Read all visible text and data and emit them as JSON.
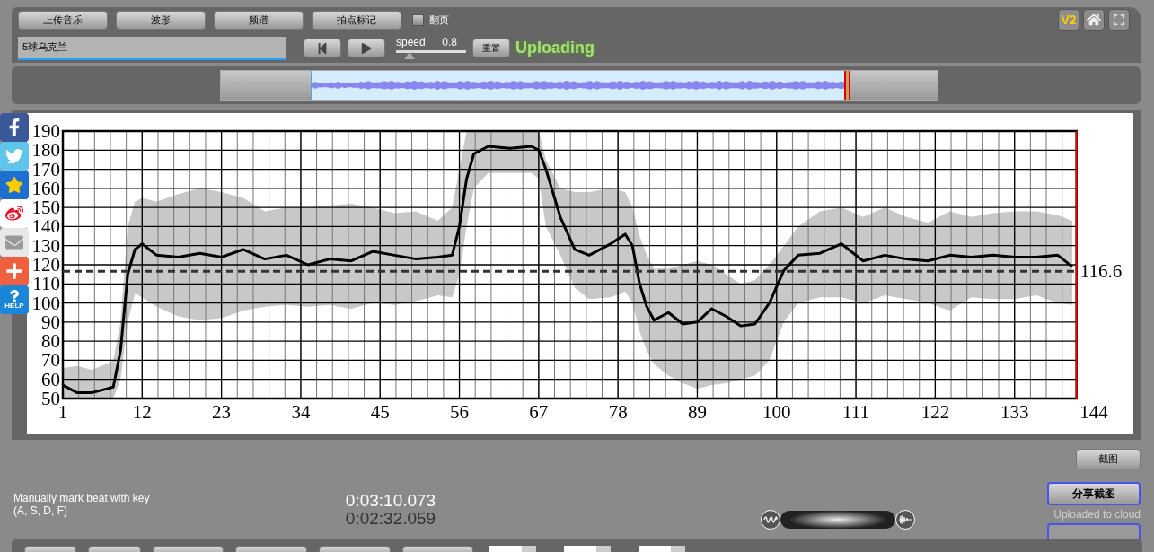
{
  "toolbar": {
    "buttons": [
      "上传音乐",
      "波形",
      "频谱",
      "拍点标记"
    ],
    "page_flip": {
      "label": "翻页",
      "checked": false
    },
    "version_badge": "V2"
  },
  "player": {
    "song_field": {
      "value": "5球乌克兰"
    },
    "speed": {
      "label": "speed",
      "value": "0.8",
      "level": 0.19
    },
    "reset_button": "重置",
    "status": "Uploading"
  },
  "overview": {
    "level": 0.87
  },
  "social": [
    {
      "kind": "facebook"
    },
    {
      "kind": "twitter"
    },
    {
      "kind": "star"
    },
    {
      "kind": "weibo"
    },
    {
      "kind": "mail"
    },
    {
      "kind": "plus"
    },
    {
      "kind": "help",
      "label": "HELP"
    }
  ],
  "chart_data": {
    "type": "line",
    "grid": true,
    "x": [
      1,
      3,
      5,
      7,
      8,
      9,
      10,
      11,
      12,
      14,
      17,
      20,
      23,
      26,
      29,
      32,
      35,
      38,
      41,
      44,
      47,
      50,
      53,
      55,
      56,
      57,
      58,
      60,
      63,
      66,
      67,
      68,
      70,
      72,
      74,
      77,
      79,
      80,
      81,
      82,
      83,
      85,
      87,
      89,
      91,
      93,
      95,
      97,
      99,
      101,
      103,
      106,
      109,
      112,
      115,
      118,
      121,
      124,
      127,
      130,
      133,
      136,
      139,
      141
    ],
    "series": [
      {
        "type": "area",
        "color": "#c8c8c8",
        "values": [
          66,
          67,
          65,
          68,
          70,
          90,
          140,
          153,
          155,
          153,
          157,
          160,
          158,
          155,
          148,
          150,
          150,
          151,
          152,
          150,
          147,
          148,
          143,
          150,
          170,
          190,
          190,
          190,
          190,
          190,
          190,
          175,
          160,
          158,
          158,
          160,
          158,
          150,
          135,
          125,
          118,
          118,
          120,
          122,
          120,
          115,
          110,
          112,
          120,
          130,
          140,
          148,
          150,
          145,
          150,
          145,
          142,
          148,
          145,
          147,
          148,
          148,
          146,
          143
        ]
      },
      {
        "type": "area",
        "color": "#ffffff",
        "values": [
          50,
          50,
          50,
          50,
          50,
          60,
          90,
          105,
          103,
          98,
          93,
          91,
          92,
          96,
          98,
          99,
          98,
          99,
          97,
          100,
          99,
          101,
          104,
          103,
          115,
          140,
          160,
          168,
          168,
          168,
          165,
          140,
          125,
          108,
          102,
          103,
          106,
          100,
          85,
          75,
          68,
          62,
          58,
          55,
          57,
          58,
          60,
          62,
          70,
          90,
          100,
          103,
          103,
          100,
          104,
          102,
          100,
          96,
          103,
          102,
          102,
          104,
          100,
          99
        ]
      },
      {
        "color": "#000000",
        "values": [
          57,
          53,
          53,
          55,
          56,
          75,
          115,
          128,
          131,
          125,
          124,
          126,
          124,
          128,
          123,
          125,
          120,
          123,
          122,
          127,
          125,
          123,
          124,
          125,
          140,
          165,
          178,
          182,
          181,
          182,
          180,
          170,
          145,
          128,
          125,
          131,
          136,
          130,
          110,
          98,
          91,
          95,
          89,
          90,
          97,
          93,
          88,
          89,
          100,
          117,
          125,
          126,
          131,
          122,
          125,
          123,
          122,
          125,
          124,
          125,
          124,
          124,
          125,
          119
        ]
      }
    ],
    "ref_lines": [
      {
        "axis": "y",
        "value": 116.6,
        "label": "116.6",
        "color": "#333333"
      },
      {
        "axis": "x",
        "value": 141.6,
        "color": "#e00000"
      }
    ],
    "xlim": [
      1,
      144
    ],
    "ylim": [
      50,
      190
    ],
    "xticks": [
      1,
      12,
      23,
      34,
      45,
      56,
      67,
      78,
      89,
      100,
      111,
      122,
      133,
      144
    ],
    "yticks": [
      50,
      60,
      70,
      80,
      90,
      100,
      110,
      120,
      130,
      140,
      150,
      160,
      170,
      180,
      190
    ]
  },
  "bottom": {
    "hint": [
      "Manually mark beat with key",
      "(A, S, D, F)"
    ],
    "times": [
      "0:03:10.073",
      "0:02:32.059"
    ],
    "screenshot_button": "截图",
    "share_button": "分享截图",
    "upload_note": "Uploaded to cloud"
  }
}
